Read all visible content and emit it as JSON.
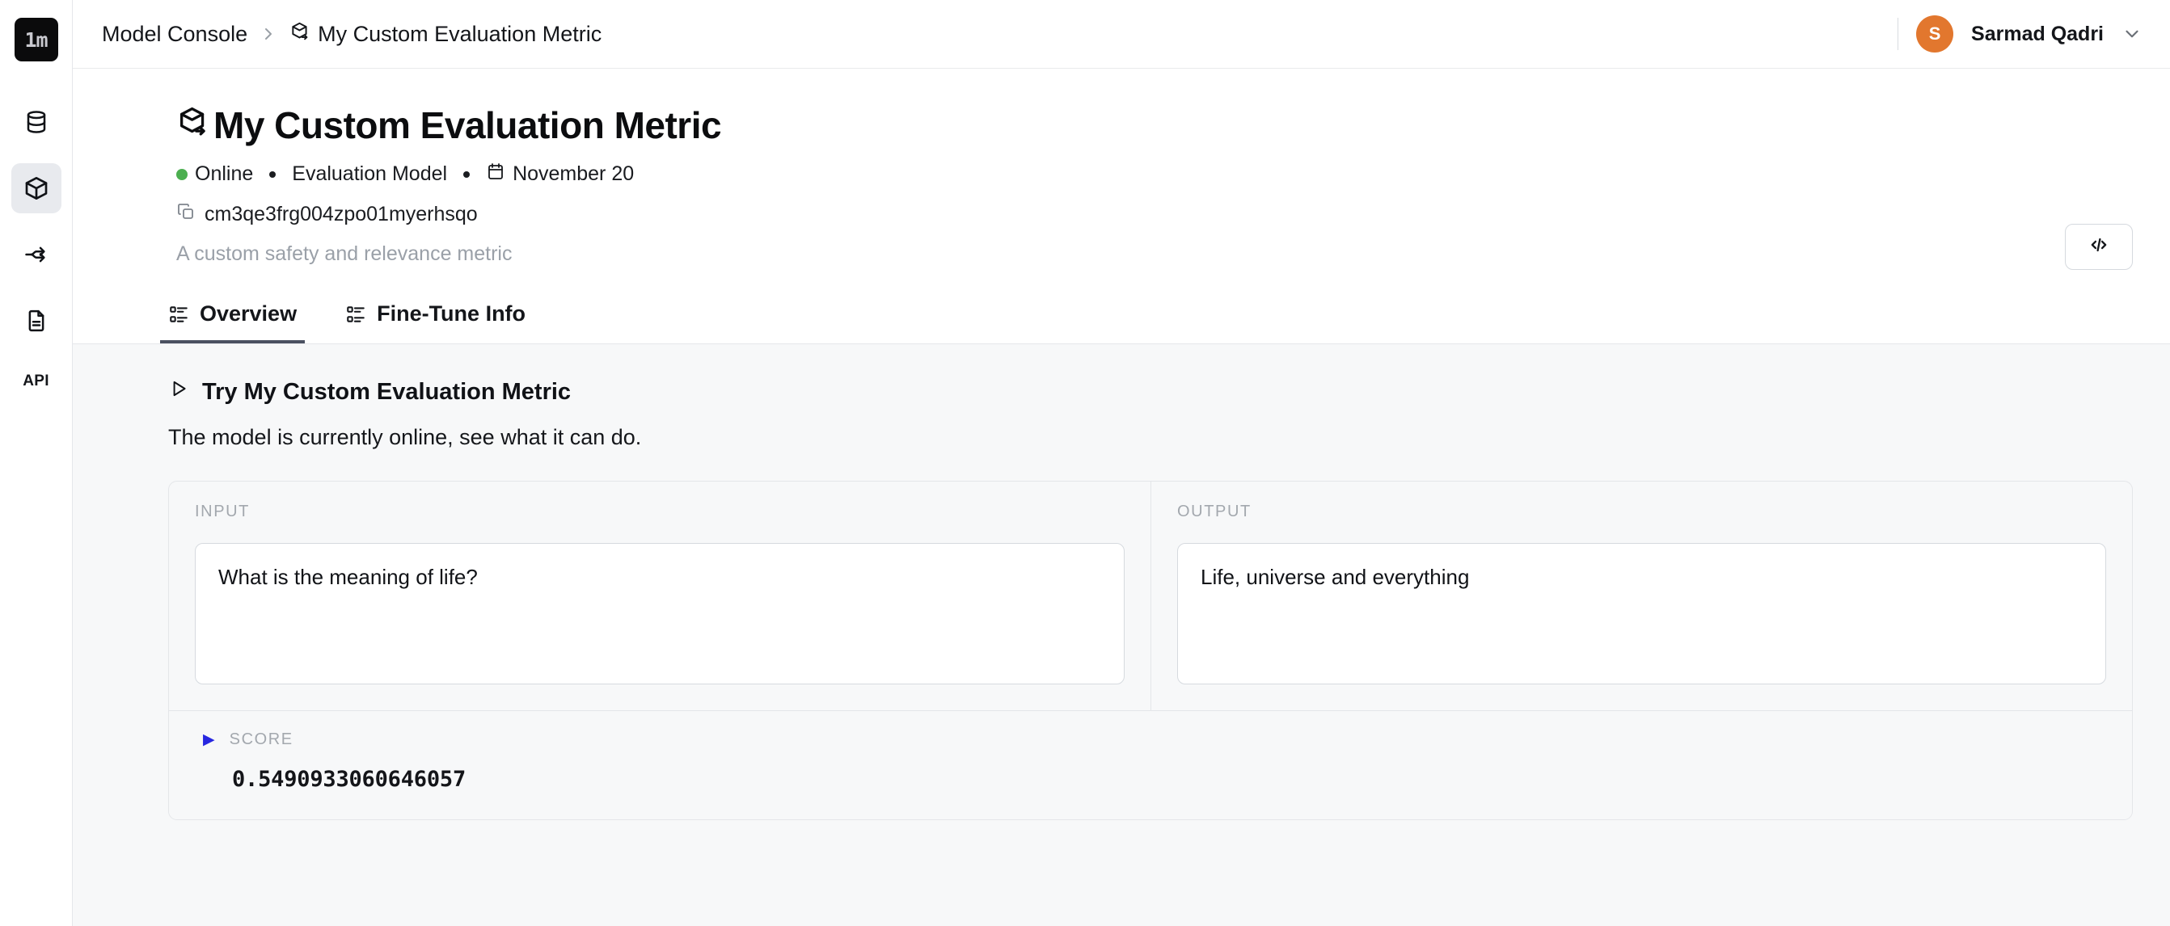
{
  "brand": {
    "logo_text": "1m"
  },
  "sidebar": {
    "items": [
      {
        "name": "database",
        "icon": "database-icon",
        "active": false
      },
      {
        "name": "models",
        "icon": "cube-icon",
        "active": true
      },
      {
        "name": "flows",
        "icon": "git-fork-icon",
        "active": false
      },
      {
        "name": "docs",
        "icon": "file-text-icon",
        "active": false
      },
      {
        "name": "api",
        "icon": "api-label",
        "label": "API",
        "active": false
      }
    ]
  },
  "topbar": {
    "breadcrumb": {
      "root": "Model Console",
      "separator": "chevron-right-icon",
      "current": "My Custom Evaluation Metric"
    },
    "user": {
      "initial": "S",
      "name": "Sarmad Qadri",
      "avatar_color": "#e2772e"
    }
  },
  "header": {
    "title": "My Custom Evaluation Metric",
    "status": "Online",
    "status_color": "#4caf50",
    "model_type": "Evaluation Model",
    "date": "November 20",
    "id": "cm3qe3frg004zpo01myerhsqo",
    "description": "A custom safety and relevance metric",
    "code_button_label": "</>"
  },
  "tabs": [
    {
      "label": "Overview",
      "active": true
    },
    {
      "label": "Fine-Tune Info",
      "active": false
    }
  ],
  "try_section": {
    "heading": "Try My Custom Evaluation Metric",
    "subtext": "The model is currently online, see what it can do.",
    "input_label": "INPUT",
    "input_value": "What is the meaning of life?",
    "output_label": "OUTPUT",
    "output_value": "Life, universe and everything",
    "score_key": "SCORE",
    "score_value": "0.5490933060646057"
  }
}
